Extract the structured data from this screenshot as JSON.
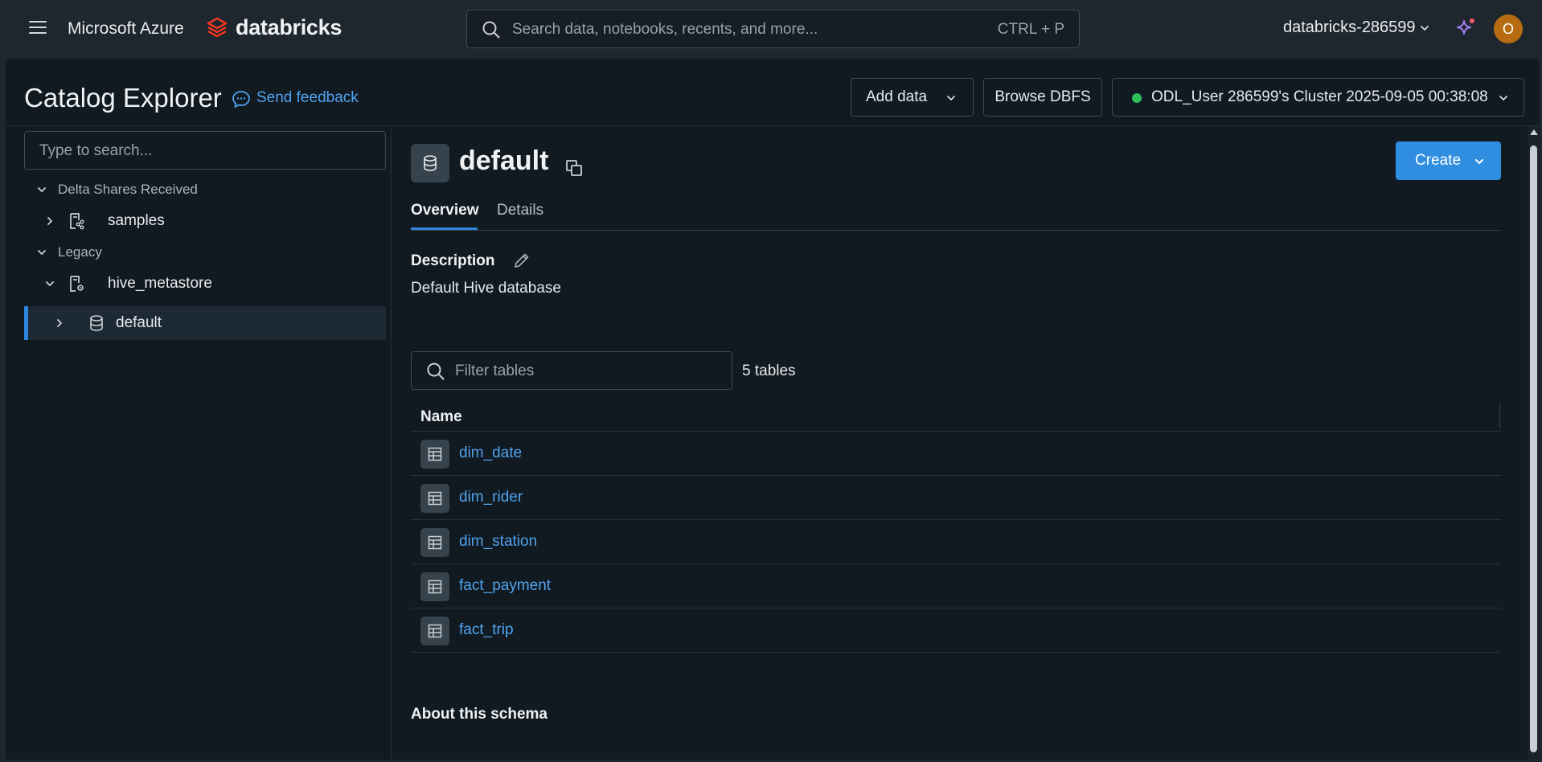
{
  "topbar": {
    "menu_icon": "hamburger-menu-icon",
    "cloud_brand": "Microsoft Azure",
    "product_brand": "databricks",
    "search_placeholder": "Search data, notebooks, recents, and more...",
    "search_shortcut": "CTRL + P",
    "workspace": "databricks-286599",
    "assistant_icon": "sparkle-icon",
    "avatar_initial": "O"
  },
  "header": {
    "title": "Catalog Explorer",
    "feedback_label": "Send feedback",
    "add_data_label": "Add data",
    "browse_dbfs_label": "Browse DBFS",
    "cluster_label": "ODL_User 286599's Cluster 2025-09-05 00:38:08",
    "cluster_status_color": "#2fbd5a"
  },
  "sidebar": {
    "search_placeholder": "Type to search...",
    "tree": [
      {
        "label": "Delta Shares Received",
        "kind": "section",
        "expanded": true
      },
      {
        "label": "samples",
        "kind": "share-catalog",
        "expanded": false
      },
      {
        "label": "Legacy",
        "kind": "section",
        "expanded": true
      },
      {
        "label": "hive_metastore",
        "kind": "catalog",
        "expanded": true
      },
      {
        "label": "default",
        "kind": "schema",
        "expanded": false,
        "selected": true
      }
    ]
  },
  "schema": {
    "name": "default",
    "create_label": "Create",
    "tabs": [
      {
        "label": "Overview",
        "active": true
      },
      {
        "label": "Details",
        "active": false
      }
    ],
    "description_label": "Description",
    "description": "Default Hive database",
    "filter_placeholder": "Filter tables",
    "table_count": "5 tables",
    "column_header": "Name",
    "tables": [
      {
        "name": "dim_date"
      },
      {
        "name": "dim_rider"
      },
      {
        "name": "dim_station"
      },
      {
        "name": "fact_payment"
      },
      {
        "name": "fact_trip"
      }
    ],
    "about_label": "About this schema"
  },
  "colors": {
    "accent": "#2f8ee0",
    "link": "#4fa3ee",
    "background": "#111a21"
  }
}
